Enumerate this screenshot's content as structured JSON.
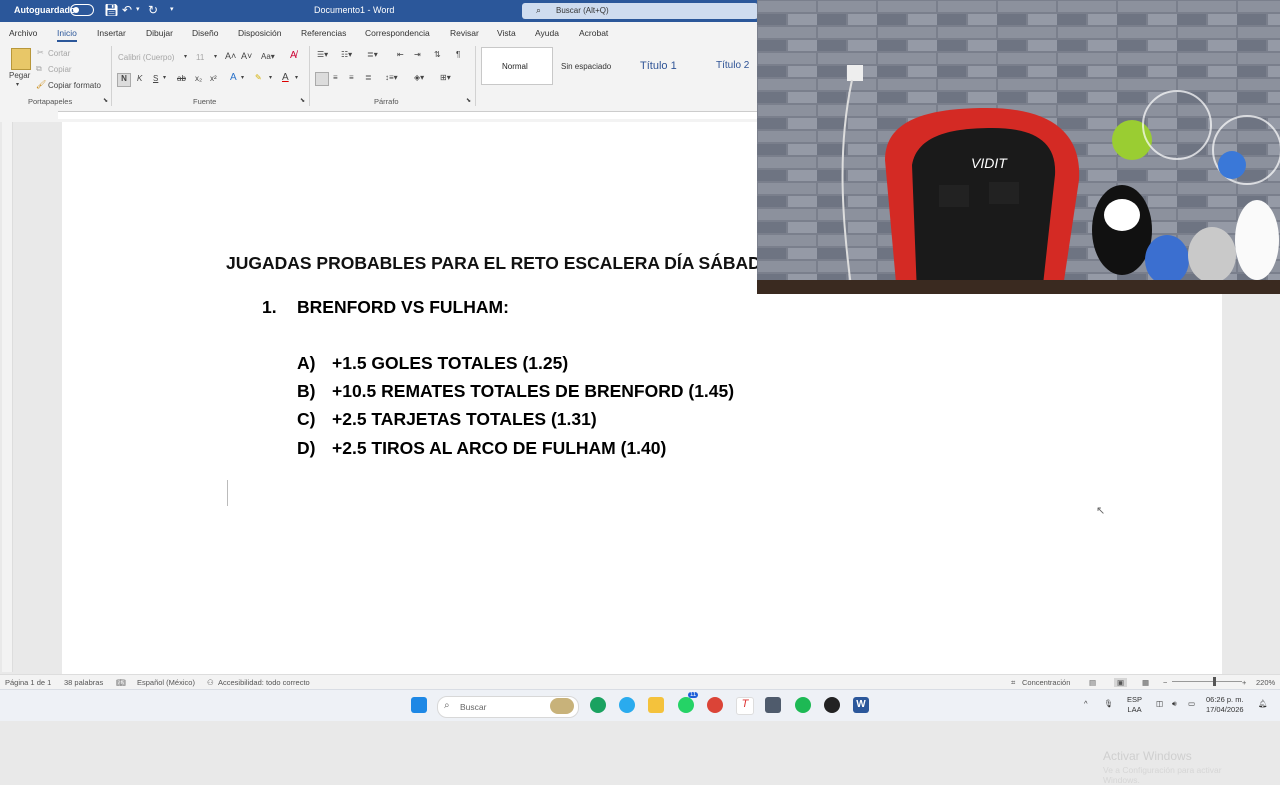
{
  "titlebar": {
    "autosave_label": "Autoguardado",
    "doc_title": "Documento1 - Word",
    "search_placeholder": "Buscar (Alt+Q)"
  },
  "tabs": [
    "Archivo",
    "Inicio",
    "Insertar",
    "Dibujar",
    "Diseño",
    "Disposición",
    "Referencias",
    "Correspondencia",
    "Revisar",
    "Vista",
    "Ayuda",
    "Acrobat"
  ],
  "active_tab": "Inicio",
  "ribbon": {
    "clipboard": {
      "paste": "Pegar",
      "cut": "Cortar",
      "copy": "Copiar",
      "format_painter": "Copiar formato",
      "group": "Portapapeles"
    },
    "font": {
      "font_name": "Calibri (Cuerpo)",
      "group": "Fuente",
      "bold": "N",
      "italic": "K",
      "underline": "S"
    },
    "paragraph": {
      "group": "Párrafo"
    },
    "styles": [
      "Normal",
      "Sin espaciado",
      "Título 1",
      "Título 2"
    ]
  },
  "document": {
    "heading": "JUGADAS PROBABLES PARA EL RETO ESCALERA DÍA SÁBADO",
    "list_number": "1.",
    "list_title": "BRENFORD VS FULHAM:",
    "options": [
      {
        "letter": "A)",
        "text": "+1.5 GOLES TOTALES (1.25)"
      },
      {
        "letter": "B)",
        "text": "+10.5 REMATES TOTALES DE BRENFORD (1.45)"
      },
      {
        "letter": "C)",
        "text": "+2.5 TARJETAS TOTALES (1.31)"
      },
      {
        "letter": "D)",
        "text": "+2.5 TIROS AL ARCO DE FULHAM (1.40)"
      }
    ]
  },
  "watermark": {
    "line1": "Activar Windows",
    "line2": "Ve a Configuración para activar Windows."
  },
  "statusbar": {
    "page": "Página 1 de 1",
    "words": "38 palabras",
    "language": "Español (México)",
    "accessibility": "Accesibilidad: todo correcto",
    "focus": "Concentración",
    "zoom": "220%"
  },
  "taskbar": {
    "search_placeholder": "Buscar",
    "lang1": "ESP",
    "lang2": "LAA",
    "time": "06:26 p. m.",
    "date": "17/04/2026",
    "whatsapp_badge": "11"
  },
  "webcam": {
    "chair_text": "VIDIT"
  },
  "colors": {
    "word_blue": "#2b579a",
    "chair_red": "#d42a24"
  }
}
